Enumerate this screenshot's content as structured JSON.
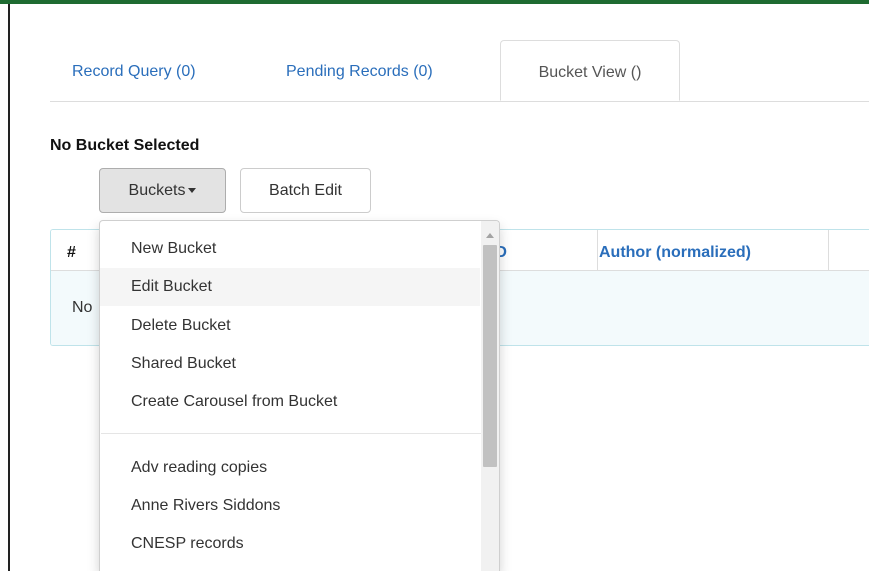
{
  "colors": {
    "top_bar": "#1e6b31",
    "link": "#2a6ebb",
    "menu_hover": "#f5f5f5",
    "table_highlight": "#f3fafc"
  },
  "tabs": [
    {
      "label": "Record Query (0)"
    },
    {
      "label": "Pending Records (0)"
    },
    {
      "label": "Bucket View ()",
      "active": true
    }
  ],
  "bucket_status": "No Bucket Selected",
  "toolbar": {
    "buckets_label": "Buckets",
    "batch_edit_label": "Batch Edit"
  },
  "table": {
    "headers": [
      "#",
      "l ID",
      "Author (normalized)"
    ],
    "empty_text": "No"
  },
  "dropdown": {
    "actions": [
      {
        "label": "New Bucket"
      },
      {
        "label": "Edit Bucket",
        "hovered": true
      },
      {
        "label": "Delete Bucket"
      },
      {
        "label": "Shared Bucket"
      },
      {
        "label": "Create Carousel from Bucket"
      }
    ],
    "buckets": [
      {
        "label": "Adv reading copies"
      },
      {
        "label": "Anne Rivers Siddons"
      },
      {
        "label": "CNESP records"
      }
    ]
  },
  "icons": {
    "buckets_caret": "caret-down-icon",
    "scroll_up": "scroll-up-arrow-icon"
  }
}
